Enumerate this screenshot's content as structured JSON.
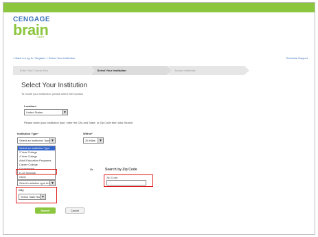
{
  "header": {
    "logo_top": "CENGAGE",
    "logo_main": "brain",
    "logo_com": ".com"
  },
  "breadcrumb": "« Back to Log In / Register > Select Your Institution",
  "support_link": "Technical Support",
  "steps": [
    {
      "label": "Enter Your Course Key",
      "active": false
    },
    {
      "label": "Select Your Institution",
      "active": true
    },
    {
      "label": "Access Materials",
      "active": false
    }
  ],
  "page_title": "Select Your Institution",
  "subtitle": "To locate your institution, please select the location",
  "location": {
    "label": "Location*",
    "value": "United States"
  },
  "instruction": "Please select your institution type, enter the City and State, or Zip Code then click Search",
  "institution_type": {
    "label": "Institution Type*",
    "value": "Select an Institution Type",
    "options": [
      "Select an Institution Type",
      "2 Year College",
      "4 Year College",
      "Adult Education Programs",
      "Career College",
      "Government",
      "K-12 Schools",
      "Other"
    ],
    "selected_index": 0
  },
  "within": {
    "label": "Within*",
    "value": "25 Miles"
  },
  "state": {
    "value": "Select Institution type first"
  },
  "or_text": "Or",
  "zip_section": {
    "heading": "Search by Zip Code",
    "label": "Zip Code",
    "placeholder": ""
  },
  "city": {
    "label": "City",
    "value": "Select State first"
  },
  "buttons": {
    "search": "Search",
    "cancel": "Cancel"
  },
  "colors": {
    "brand_green": "#8cc63f",
    "brand_blue": "#3b74b9",
    "highlight_red": "#e01515",
    "selection_blue": "#3366cc"
  }
}
